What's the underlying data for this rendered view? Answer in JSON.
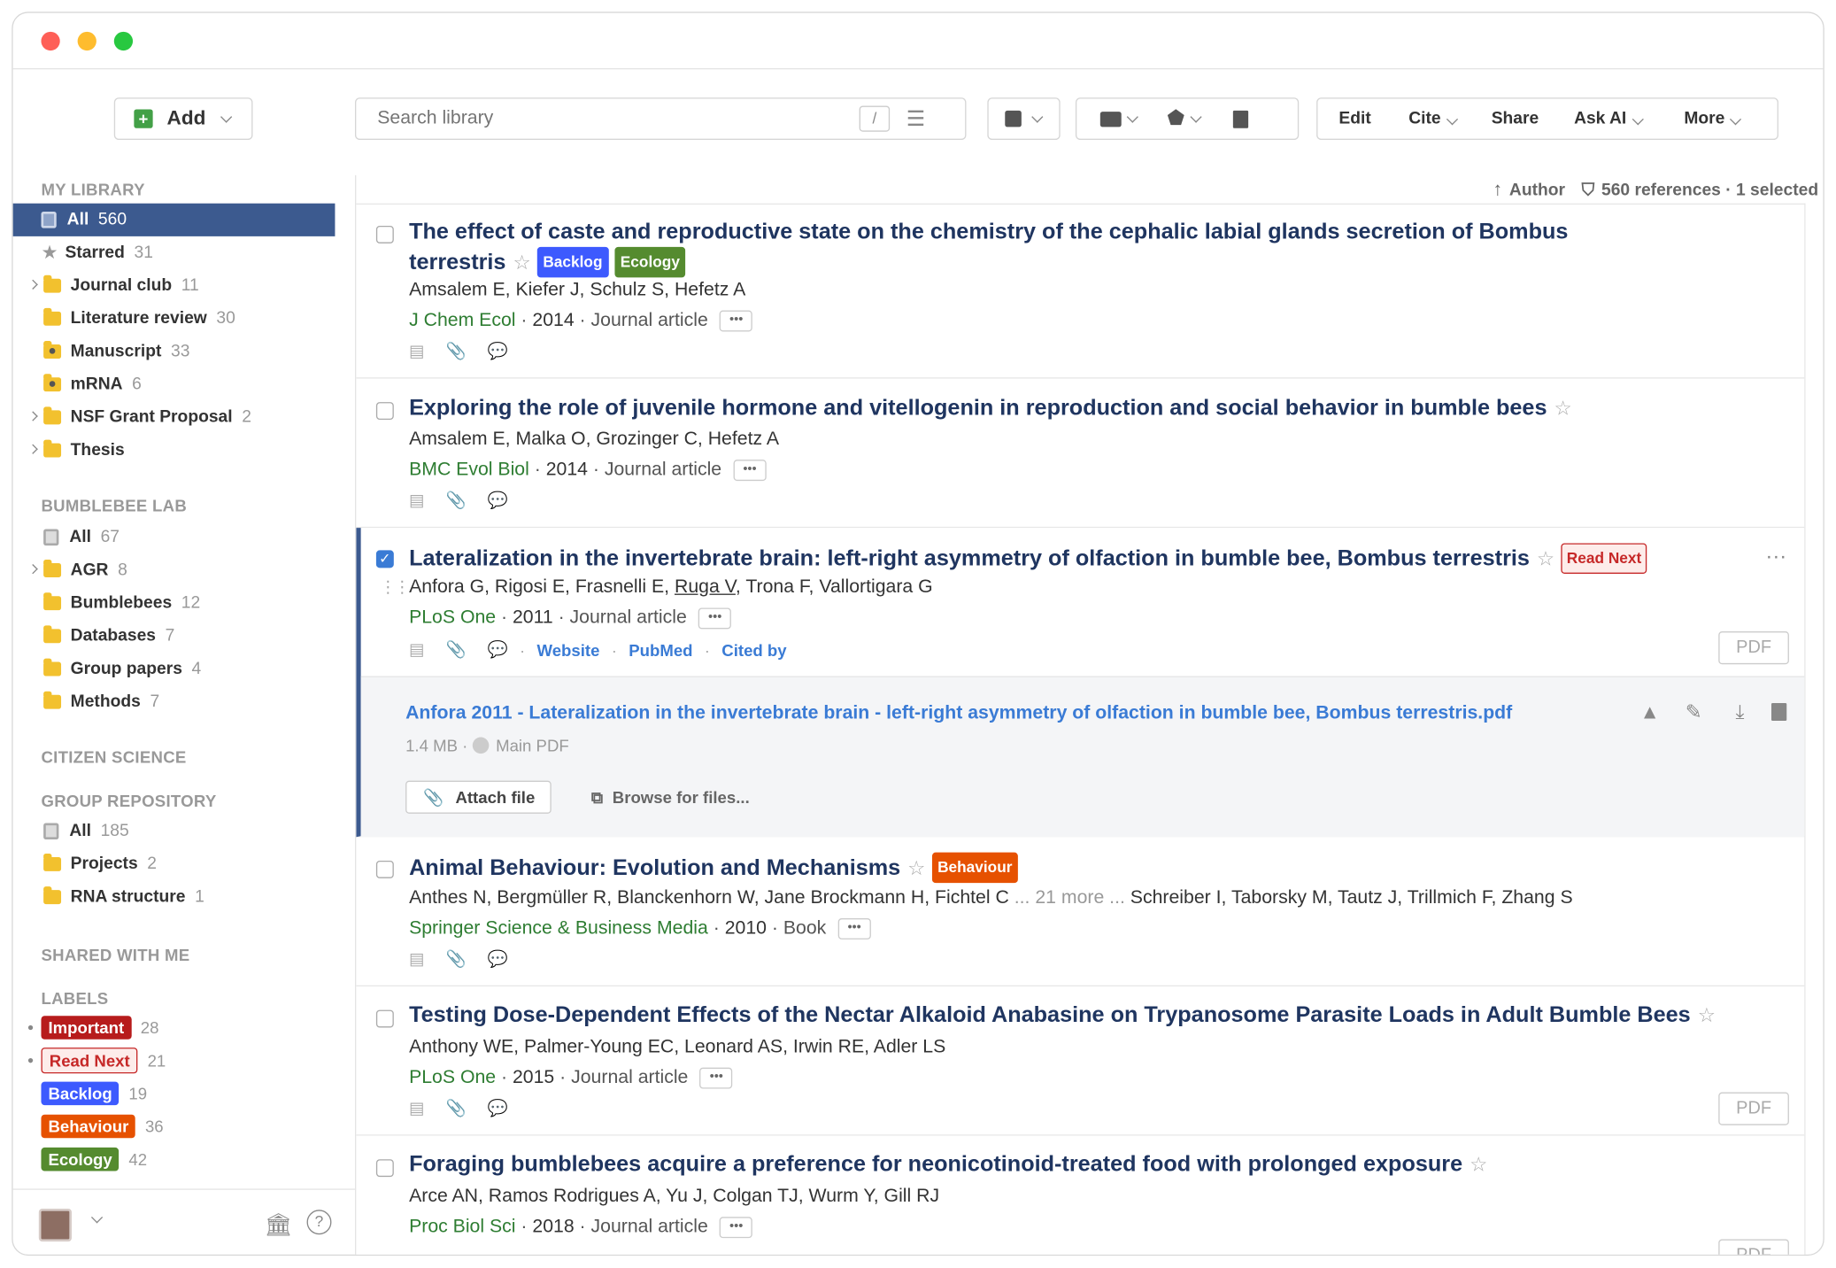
{
  "toolbar": {
    "add": "Add",
    "search_placeholder": "Search library",
    "search_shortcut": "/",
    "edit": "Edit",
    "cite": "Cite",
    "share": "Share",
    "ask_ai": "Ask AI",
    "more": "More"
  },
  "list_header": {
    "sort": "Author",
    "count": "560 references · 1 selected"
  },
  "sidebar": {
    "my_library": "MY LIBRARY",
    "my_items": [
      {
        "label": "All",
        "count": "560"
      },
      {
        "label": "Starred",
        "count": "31"
      },
      {
        "label": "Journal club",
        "count": "11"
      },
      {
        "label": "Literature review",
        "count": "30"
      },
      {
        "label": "Manuscript",
        "count": "33"
      },
      {
        "label": "mRNA",
        "count": "6"
      },
      {
        "label": "NSF Grant Proposal",
        "count": "2"
      },
      {
        "label": "Thesis",
        "count": ""
      }
    ],
    "bumblebee": "BUMBLEBEE LAB",
    "bee_items": [
      {
        "label": "All",
        "count": "67"
      },
      {
        "label": "AGR",
        "count": "8"
      },
      {
        "label": "Bumblebees",
        "count": "12"
      },
      {
        "label": "Databases",
        "count": "7"
      },
      {
        "label": "Group papers",
        "count": "4"
      },
      {
        "label": "Methods",
        "count": "7"
      }
    ],
    "citizen": "CITIZEN SCIENCE",
    "group_repo": "GROUP REPOSITORY",
    "repo_items": [
      {
        "label": "All",
        "count": "185"
      },
      {
        "label": "Projects",
        "count": "2"
      },
      {
        "label": "RNA structure",
        "count": "1"
      }
    ],
    "shared": "SHARED WITH ME",
    "labels": "LABELS",
    "label_items": [
      {
        "label": "Important",
        "count": "28",
        "color": "#b71c1c"
      },
      {
        "label": "Read Next",
        "count": "21",
        "color": "#c62828"
      },
      {
        "label": "Backlog",
        "count": "19",
        "color": "#3d5afe"
      },
      {
        "label": "Behaviour",
        "count": "36",
        "color": "#e65100"
      },
      {
        "label": "Ecology",
        "count": "42",
        "color": "#558b2f"
      }
    ]
  },
  "refs": [
    {
      "title1": "The effect of caste and reproductive state on the chemistry of the cephalic labial glands secretion of Bombus",
      "title2": "terrestris",
      "tags": [
        "Backlog",
        "Ecology"
      ],
      "authors": "Amsalem E, Kiefer J, Schulz S, Hefetz A",
      "journal": "J Chem Ecol",
      "year": "2014",
      "type": "Journal article"
    },
    {
      "title1": "Exploring the role of juvenile hormone and vitellogenin in reproduction and social behavior in bumble bees",
      "authors": "Amsalem E, Malka O, Grozinger C, Hefetz A",
      "journal": "BMC Evol Biol",
      "year": "2014",
      "type": "Journal article"
    },
    {
      "title1": "Lateralization in the invertebrate brain: left-right asymmetry of olfaction in bumble bee, Bombus terrestris",
      "tags": [
        "Read Next"
      ],
      "authors_a": "Anfora G, Rigosi E, Frasnelli E, ",
      "authors_u": "Ruga V",
      "authors_b": ", Trona F, Vallortigara G",
      "journal": "PLoS One",
      "year": "2011",
      "type": "Journal article",
      "links": [
        "Website",
        "PubMed",
        "Cited by"
      ],
      "pdf": "PDF"
    },
    {
      "title1": "Animal Behaviour: Evolution and Mechanisms",
      "tags": [
        "Behaviour"
      ],
      "authors": "Anthes N, Bergmüller R, Blanckenhorn W, Jane Brockmann H, Fichtel C",
      "authors_more": " ... 21 more ... ",
      "authors_end": "Schreiber I, Taborsky M, Tautz J, Trillmich F, Zhang S",
      "journal": "Springer Science & Business Media",
      "year": "2010",
      "type": "Book"
    },
    {
      "title1": "Testing Dose-Dependent Effects of the Nectar Alkaloid Anabasine on Trypanosome Parasite Loads in Adult Bumble Bees",
      "authors": "Anthony WE, Palmer-Young EC, Leonard AS, Irwin RE, Adler LS",
      "journal": "PLoS One",
      "year": "2015",
      "type": "Journal article",
      "pdf": "PDF"
    },
    {
      "title1": "Foraging bumblebees acquire a preference for neonicotinoid-treated food with prolonged exposure",
      "authors": "Arce AN, Ramos Rodrigues A, Yu J, Colgan TJ, Wurm Y, Gill RJ",
      "journal": "Proc Biol Sci",
      "year": "2018",
      "type": "Journal article",
      "pdf": "PDF"
    }
  ],
  "attachment": {
    "file": "Anfora 2011 - Lateralization in the invertebrate brain - left-right asymmetry of olfaction in bumble bee, Bombus terrestris.pdf",
    "size": "1.4 MB",
    "main": "Main PDF",
    "attach": "Attach file",
    "browse": "Browse for files..."
  }
}
